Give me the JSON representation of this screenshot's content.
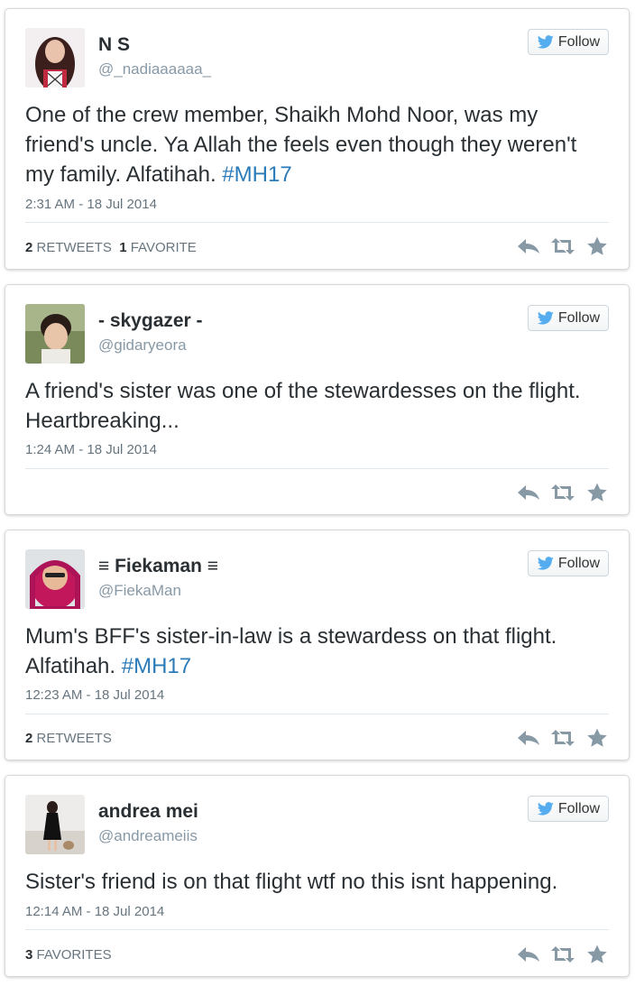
{
  "colors": {
    "link": "#2b7bb9",
    "muted": "#8899a6",
    "icon": "#8899a6",
    "twitter_blue": "#55acee"
  },
  "follow_label": "Follow",
  "tweets": [
    {
      "name": "N S",
      "handle": "@_nadiaaaaaa_",
      "text_parts": [
        "One of the crew member, Shaikh Mohd Noor, was my friend's uncle. Ya Allah the feels even though they weren't my family. Alfatihah. ",
        "#MH17"
      ],
      "time": "2:31 AM - 18 Jul 2014",
      "stats": {
        "retweets_count": "2",
        "retweets_label": "RETWEETS",
        "favorites_count": "1",
        "favorites_label": "FAVORITE"
      }
    },
    {
      "name": "- skygazer -",
      "handle": "@gidaryeora",
      "text_parts": [
        "A friend's sister was one of the stewardesses on the flight. Heartbreaking...",
        ""
      ],
      "time": "1:24 AM - 18 Jul 2014",
      "stats": null
    },
    {
      "name": "≡ Fiekaman ≡",
      "handle": "@FiekaMan",
      "text_parts": [
        "Mum's BFF's sister-in-law is a stewardess on that flight. Alfatihah. ",
        "#MH17"
      ],
      "time": "12:23 AM - 18 Jul 2014",
      "stats": {
        "retweets_count": "2",
        "retweets_label": "RETWEETS",
        "favorites_count": "",
        "favorites_label": ""
      }
    },
    {
      "name": "andrea mei",
      "handle": "@andreameiis",
      "text_parts": [
        "Sister's friend is on that flight wtf no this isnt happening.",
        ""
      ],
      "time": "12:14 AM - 18 Jul 2014",
      "stats": {
        "retweets_count": "",
        "retweets_label": "",
        "favorites_count": "3",
        "favorites_label": "FAVORITES"
      }
    }
  ]
}
